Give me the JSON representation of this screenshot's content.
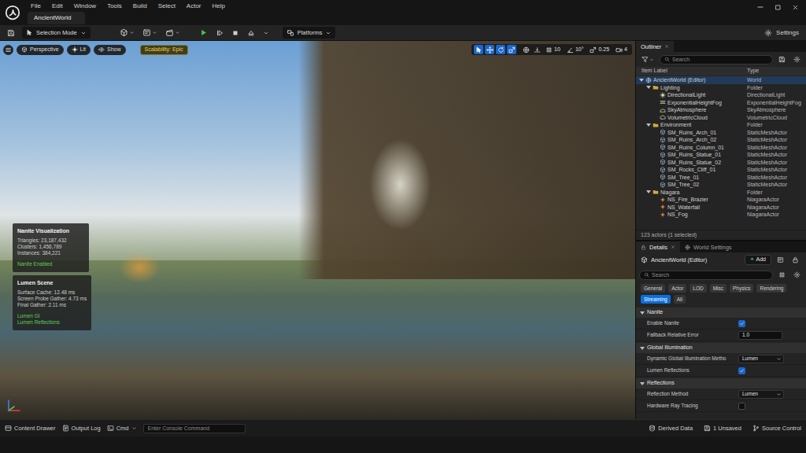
{
  "app": {
    "tab": "AncientWorld",
    "menu": [
      "File",
      "Edit",
      "Window",
      "Tools",
      "Build",
      "Select",
      "Actor",
      "Help"
    ]
  },
  "toolbar": {
    "mode": "Selection Mode",
    "platforms": "Platforms",
    "settings": "Settings"
  },
  "viewport": {
    "view_buttons": [
      {
        "label": "Perspective",
        "kind": "perspective"
      },
      {
        "label": "Lit",
        "kind": "lit"
      },
      {
        "label": "Show",
        "kind": "show"
      }
    ],
    "scalability": "Scalability: Epic",
    "tools": [
      {
        "kind": "select",
        "selected": true
      },
      {
        "kind": "move",
        "selected": true
      },
      {
        "kind": "rotate",
        "selected": true
      },
      {
        "kind": "scale",
        "selected": true
      }
    ],
    "snaps": [
      {
        "kind": "grid",
        "label": "10"
      },
      {
        "kind": "angle",
        "label": "10°"
      },
      {
        "kind": "scale",
        "label": "0.25"
      },
      {
        "kind": "camera",
        "label": "4"
      }
    ],
    "stats": [
      {
        "title": "Nanite Visualization",
        "lines": [
          {
            "text": "Triangles: 23,187,432",
            "kind": "stat"
          },
          {
            "text": "Clusters: 1,456,789",
            "kind": "stat"
          },
          {
            "text": "Instances: 384,221",
            "kind": "stat"
          },
          {
            "text": "Nanite Enabled",
            "kind": "flag"
          }
        ]
      },
      {
        "title": "Lumen Scene",
        "lines": [
          {
            "text": "Surface Cache: 12.48 ms",
            "kind": "stat"
          },
          {
            "text": "Screen Probe Gather: 4.73 ms",
            "kind": "stat"
          },
          {
            "text": "Final Gather: 2.11 ms",
            "kind": "stat"
          },
          {
            "text": "Lumen GI",
            "kind": "flag"
          },
          {
            "text": "Lumen Reflections",
            "kind": "flag"
          }
        ]
      }
    ]
  },
  "outliner": {
    "title": "Outliner",
    "search": {
      "placeholder": "Search"
    },
    "columns": [
      "Item Label",
      "Type"
    ],
    "tree": [
      {
        "label": "AncientWorld (Editor)",
        "type": "World",
        "kind": "world",
        "expanded": true,
        "selected": true,
        "children": [
          {
            "label": "Lighting",
            "type": "Folder",
            "kind": "folder",
            "expanded": true,
            "selected": false,
            "children": [
              {
                "label": "DirectionalLight",
                "type": "DirectionalLight",
                "kind": "light",
                "selected": false
              },
              {
                "label": "ExponentialHeightFog",
                "type": "ExponentialHeightFog",
                "kind": "fog",
                "selected": false
              },
              {
                "label": "SkyAtmosphere",
                "type": "SkyAtmosphere",
                "kind": "sky",
                "selected": false
              },
              {
                "label": "VolumetricCloud",
                "type": "VolumetricCloud",
                "kind": "cloud",
                "selected": false
              }
            ]
          },
          {
            "label": "Environment",
            "type": "Folder",
            "kind": "folder",
            "expanded": true,
            "selected": false,
            "children": [
              {
                "label": "SM_Ruins_Arch_01",
                "type": "StaticMeshActor",
                "kind": "mesh",
                "selected": false
              },
              {
                "label": "SM_Ruins_Arch_02",
                "type": "StaticMeshActor",
                "kind": "mesh",
                "selected": false
              },
              {
                "label": "SM_Ruins_Column_01",
                "type": "StaticMeshActor",
                "kind": "mesh",
                "selected": false
              },
              {
                "label": "SM_Ruins_Statue_01",
                "type": "StaticMeshActor",
                "kind": "mesh",
                "selected": false
              },
              {
                "label": "SM_Ruins_Statue_02",
                "type": "StaticMeshActor",
                "kind": "mesh",
                "selected": false
              },
              {
                "label": "SM_Rocks_Cliff_01",
                "type": "StaticMeshActor",
                "kind": "mesh",
                "selected": false
              },
              {
                "label": "SM_Tree_01",
                "type": "StaticMeshActor",
                "kind": "mesh",
                "selected": false
              },
              {
                "label": "SM_Tree_02",
                "type": "StaticMeshActor",
                "kind": "mesh",
                "selected": false
              }
            ]
          },
          {
            "label": "Niagara",
            "type": "Folder",
            "kind": "folder",
            "expanded": true,
            "selected": false,
            "children": [
              {
                "label": "NS_Fire_Brazier",
                "type": "NiagaraActor",
                "kind": "niagara",
                "selected": false
              },
              {
                "label": "NS_Waterfall",
                "type": "NiagaraActor",
                "kind": "niagara",
                "selected": false
              },
              {
                "label": "NS_Fog",
                "type": "NiagaraActor",
                "kind": "niagara",
                "selected": false
              }
            ]
          }
        ]
      }
    ],
    "footer": "123 actors (1 selected)"
  },
  "details": {
    "tabs": [
      {
        "label": "Details",
        "selected": true
      },
      {
        "label": "World Settings",
        "selected": false
      }
    ],
    "object": "AncientWorld (Editor)",
    "add": {
      "icon": "+",
      "label": "Add"
    },
    "search": {
      "placeholder": "Search"
    },
    "filters": [
      {
        "label": "General",
        "selected": false
      },
      {
        "label": "Actor",
        "selected": false
      },
      {
        "label": "LOD",
        "selected": false
      },
      {
        "label": "Misc",
        "selected": false
      },
      {
        "label": "Physics",
        "selected": false
      },
      {
        "label": "Rendering",
        "selected": false
      },
      {
        "label": "Streaming",
        "selected": true
      },
      {
        "label": "All",
        "selected": false
      }
    ],
    "sections": [
      {
        "title": "Nanite",
        "expanded": true,
        "props": [
          {
            "label": "Enable Nanite",
            "kind": "checkbox",
            "checked": true
          },
          {
            "label": "Fallback Relative Error",
            "kind": "number",
            "value": "1.0"
          }
        ]
      },
      {
        "title": "Global Illumination",
        "expanded": true,
        "props": [
          {
            "label": "Dynamic Global Illumination Metho",
            "kind": "dropdown",
            "value": "Lumen"
          },
          {
            "label": "Lumen Reflections",
            "kind": "checkbox",
            "checked": true
          }
        ]
      },
      {
        "title": "Reflections",
        "expanded": true,
        "props": [
          {
            "label": "Reflection Method",
            "kind": "dropdown",
            "value": "Lumen"
          },
          {
            "label": "Hardware Ray Tracing",
            "kind": "checkbox",
            "checked": false
          }
        ]
      }
    ]
  },
  "status_bar": {
    "left": [
      {
        "label": "Content Drawer",
        "kind": "drawer"
      },
      {
        "label": "Output Log",
        "kind": "log"
      }
    ],
    "cmd": "Cmd",
    "console": {
      "placeholder": "Enter Console Command"
    },
    "right": [
      {
        "label": "Derived Data",
        "kind": "data"
      },
      {
        "label": "1 Unsaved",
        "kind": "unsaved"
      },
      {
        "label": "Source Control",
        "kind": "source"
      }
    ]
  }
}
